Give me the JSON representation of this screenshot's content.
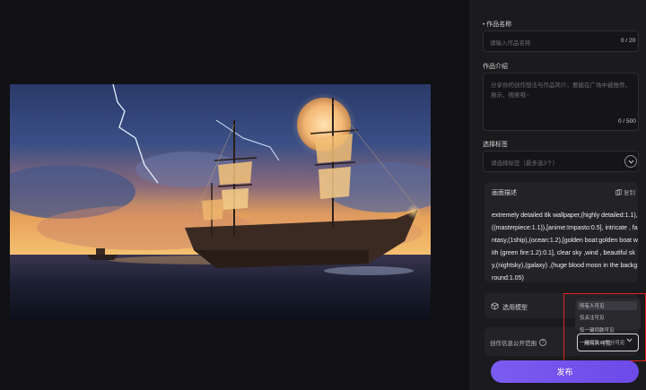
{
  "form": {
    "title_label": "作品名称",
    "title_placeholder": "请输入作品名称",
    "title_counter": "0 / 20",
    "intro_label": "作品介绍",
    "intro_placeholder": "分享你的创作想法与作品简介，要能在广场中被推荐，展示，搜索哦~",
    "intro_counter": "0 / 500",
    "tags_label": "选择标签",
    "tags_placeholder": "请选择标签（最多选3个）"
  },
  "description": {
    "title": "画面描述",
    "copy_label": "复制",
    "text": "extremely detailed 8k wallpaper,(highly detailed:1.1), ((masterpiece:1.1)),[anime:Impasto:0.5], intricate , fantasy,(1ship),(ocean:1.2),[golden boat:golden boat with (green fire:1.2):0.1], clear sky ,wind , beautiful sky,(nightsky),(galaxy) ,(huge blood moon in the background:1.05)"
  },
  "model": {
    "label": "选用模型"
  },
  "visibility": {
    "label": "创作信息公开范围",
    "help_icon": "?",
    "selected": "所有人可见",
    "options": [
      "所有人可见",
      "仅关注可见",
      "仅一键同款可见",
      "一键同款+1积分可见"
    ]
  },
  "publish_label": "发布",
  "colors": {
    "accent": "#7b5cf0",
    "highlight": "#e02121"
  }
}
